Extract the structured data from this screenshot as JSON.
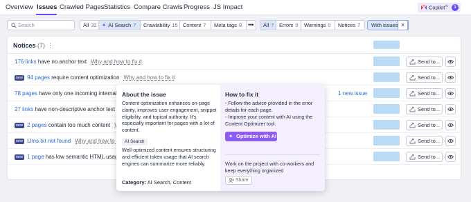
{
  "nav": {
    "tabs": [
      "Overview",
      "Issues",
      "Crawled Pages",
      "Statistics",
      "Compare Crawls",
      "Progress",
      "JS Impact"
    ],
    "active_tab": "Issues",
    "copilot": {
      "label": "Copilot",
      "superscript": "AI",
      "badge": "1"
    }
  },
  "filters": {
    "search": {
      "placeholder": "Search",
      "value": ""
    },
    "categories": [
      {
        "label": "All",
        "count": "32"
      },
      {
        "label": "AI Search",
        "count": "7",
        "selected": true
      },
      {
        "label": "Crawlability",
        "count": "15"
      },
      {
        "label": "Content",
        "count": "7"
      },
      {
        "label": "Meta tags",
        "count": "8"
      }
    ],
    "more_label": "•••",
    "severities": [
      {
        "label": "All",
        "count": "7",
        "selected": true
      },
      {
        "label": "Errors",
        "count": "0"
      },
      {
        "label": "Warnings",
        "count": "0"
      },
      {
        "label": "Notices",
        "count": "7"
      }
    ],
    "with_issues": "With issues",
    "close_symbol": "×"
  },
  "panel": {
    "title": "Notices",
    "count": "(7)",
    "menu": "⋮",
    "send_label": "Send to...",
    "why_label": "Why and how to fix it",
    "new_badge": "new",
    "rows": [
      {
        "link": "176 links",
        "text": "have no anchor text",
        "is_new": false
      },
      {
        "link": "94 pages",
        "text": "require content optimization",
        "is_new": true
      },
      {
        "link": "78 pages",
        "text": "have only one incoming internal lin",
        "is_new": false,
        "new_issue": "1 new issue"
      },
      {
        "link": "27 links",
        "text": "have non-descriptive anchor text",
        "is_new": false
      },
      {
        "link": "2 pages",
        "text": "contain too much content",
        "is_new": true
      },
      {
        "link": "Llms.txt not found",
        "text": "",
        "is_new": true
      },
      {
        "link": "1 page",
        "text": "has low semantic HTML usage",
        "is_new": true
      }
    ]
  },
  "popover": {
    "about_title": "About the issue",
    "about_text": "Content optimization enhances on-page clarity, improves user engagement, snippet eligibility, and topical authority. It's especially important for pages with a lot of content.",
    "tag": "AI Search",
    "tag_text": "Well-optimized content ensures structuring and efficient token usage that AI search engines can summarize more reliably.",
    "category_label": "Category:",
    "category_value": "AI Search, Content",
    "fix_title": "How to fix it",
    "fix_lines": [
      "- Follow the advice provided in the error details for each page.",
      "- Improve your content with AI using the Content Optimizer tool."
    ],
    "optimize_label": "Optimize with AI",
    "cowork_text": "Work on the project with co-workers and keep everything organized",
    "share_label": "Share"
  },
  "colors": {
    "accent": "#6b4cf6",
    "link": "#2c6bd6",
    "selected_bg": "#dce6fb",
    "popover_right_bg": "#f5efff",
    "optimize_btn": "#8e5cf3",
    "new_badge": "#3e4a91",
    "spark_bar": "#b9dbf6"
  },
  "icons": [
    "copilot-icon",
    "search-icon",
    "sparkle-icon",
    "more-icon",
    "close-icon",
    "send-arrow-icon",
    "eye-icon",
    "share-user-icon"
  ]
}
